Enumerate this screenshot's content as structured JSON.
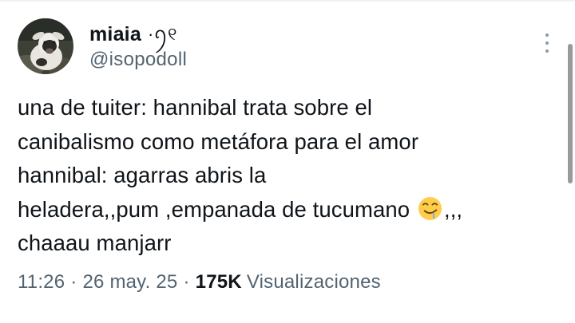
{
  "author": {
    "display_name": "miaia",
    "name_decoration": "·ꪆ୧",
    "handle": "@isopodoll"
  },
  "avatar": {
    "icon": "calf-photo-avatar"
  },
  "more_menu": {
    "icon": "vertical-ellipsis-icon"
  },
  "tweet": {
    "lines": [
      "una de tuiter: hannibal trata sobre el",
      "canibalismo como metáfora para el amor",
      "hannibal: agarras abris la",
      "heladera,,pum ,empanada de tucumano",
      "chaaau manjarr"
    ],
    "emoji": "drooling-face-emoji",
    "after_emoji": ",,,"
  },
  "meta": {
    "time": "11:26",
    "date": "26 may. 25",
    "views_count": "175K",
    "views_label": "Visualizaciones",
    "separator": "·"
  }
}
